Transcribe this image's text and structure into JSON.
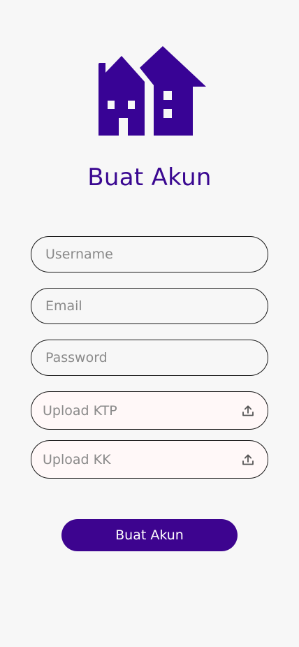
{
  "logo": {
    "icon": "houses-logo-icon",
    "color": "#380395"
  },
  "title": "Buat Akun",
  "form": {
    "username": {
      "placeholder": "Username",
      "value": ""
    },
    "email": {
      "placeholder": "Email",
      "value": ""
    },
    "password": {
      "placeholder": "Password",
      "value": ""
    },
    "upload_ktp": {
      "label": "Upload KTP",
      "icon": "upload-icon"
    },
    "upload_kk": {
      "label": "Upload KK",
      "icon": "upload-icon"
    }
  },
  "submit": {
    "label": "Buat Akun",
    "color": "#3d048f"
  },
  "colors": {
    "accent": "#3a0891",
    "background": "#f7f7f7",
    "upload_bg": "#fff8f8"
  }
}
